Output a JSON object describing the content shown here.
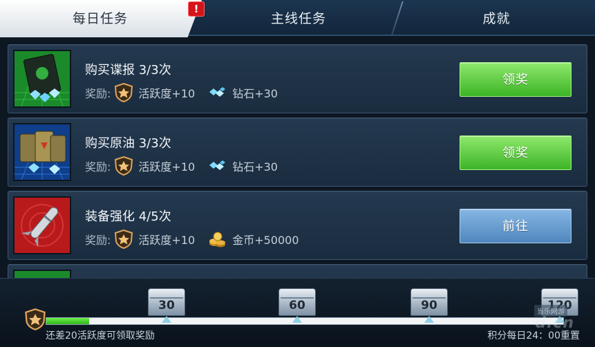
{
  "tabs": [
    {
      "label": "每日任务",
      "active": true
    },
    {
      "label": "主线任务",
      "active": false
    },
    {
      "label": "成就",
      "active": false
    }
  ],
  "alert_badge": "!",
  "reward_prefix": "奖励:",
  "tasks": [
    {
      "title": "购买谍报 3/3次",
      "icon": "spy-intel-icon",
      "rewards": [
        {
          "icon": "activity-badge-icon",
          "text": "活跃度+10"
        },
        {
          "icon": "diamond-icon",
          "text": "钻石+30"
        }
      ],
      "button": "领奖",
      "button_style": "green"
    },
    {
      "title": "购买原油 3/3次",
      "icon": "oil-barrels-icon",
      "rewards": [
        {
          "icon": "activity-badge-icon",
          "text": "活跃度+10"
        },
        {
          "icon": "diamond-icon",
          "text": "钻石+30"
        }
      ],
      "button": "领奖",
      "button_style": "green"
    },
    {
      "title": "装备强化 4/5次",
      "icon": "missile-icon",
      "rewards": [
        {
          "icon": "activity-badge-icon",
          "text": "活跃度+10"
        },
        {
          "icon": "gold-coins-icon",
          "text": "金币+50000"
        }
      ],
      "button": "前往",
      "button_style": "blue"
    }
  ],
  "progress": {
    "current": 10,
    "max": 120,
    "milestones": [
      "30",
      "60",
      "90",
      "120"
    ],
    "hint": "还差20活跃度可领取奖励",
    "reset_note": "积分每日24：00重置"
  },
  "watermark": {
    "small": "当乐网游",
    "brand": "d.cn"
  },
  "colors": {
    "green_button": "#4fc434",
    "blue_button": "#6a9fd2",
    "progress_green": "#4fdc36",
    "panel_bg": "#1f3347"
  }
}
